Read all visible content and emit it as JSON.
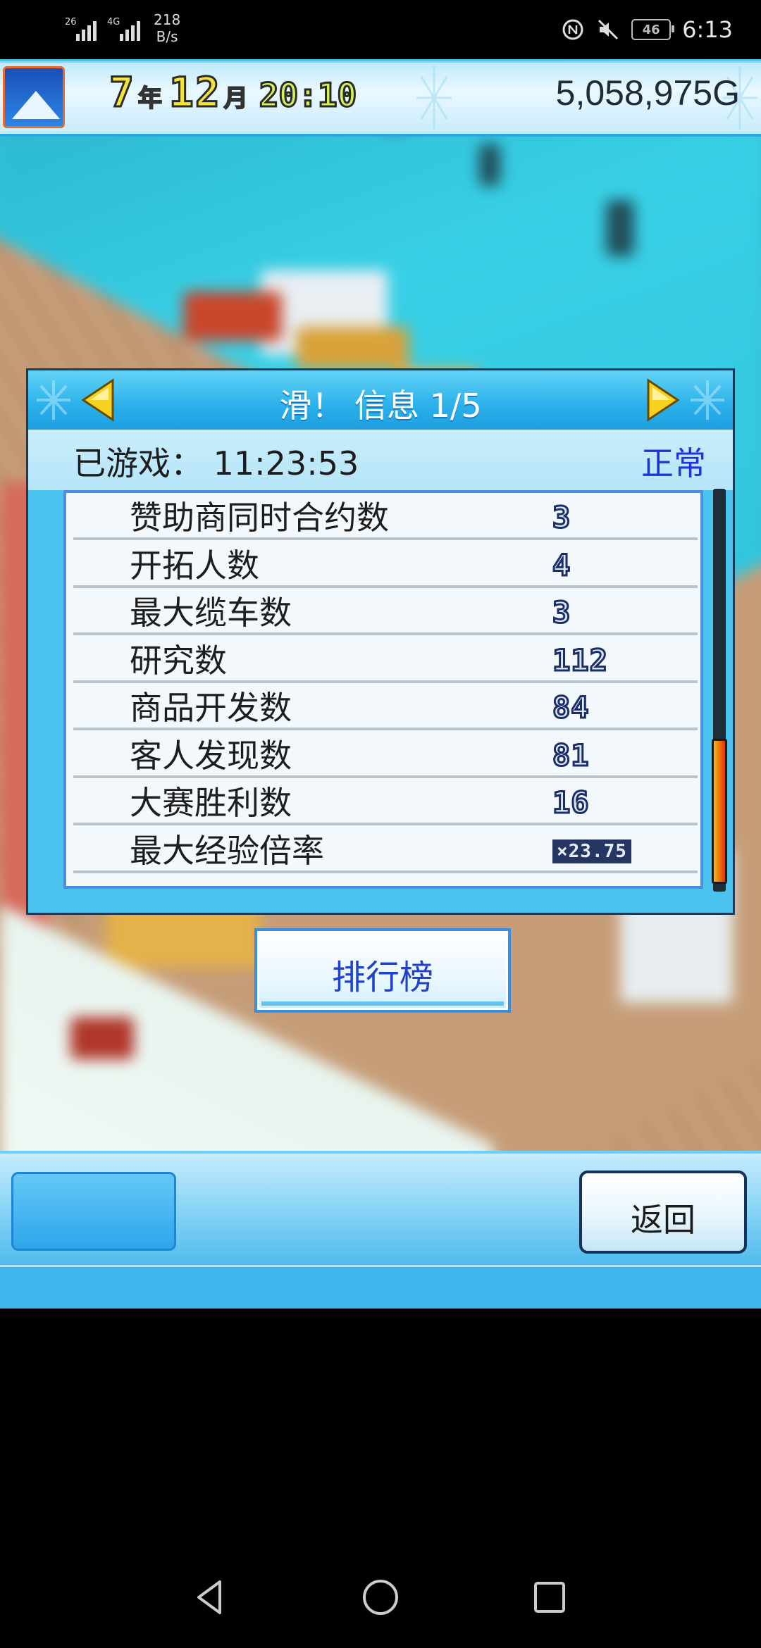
{
  "status_bar": {
    "signal1_label": "26",
    "signal2_label": "4G",
    "net_speed_value": "218",
    "net_speed_unit": "B/s",
    "battery": "46",
    "clock": "6:13",
    "icons": [
      "signal-icon",
      "signal-icon",
      "nfc-icon",
      "mute-icon",
      "battery-icon"
    ]
  },
  "hud": {
    "year": "7",
    "year_unit": "年",
    "month": "12",
    "month_unit": "月",
    "time": "20:10",
    "money": "5,058,975G"
  },
  "info_panel": {
    "title": "滑！ 信息 1/5",
    "played_label": "已游戏：",
    "played_time": "11:23:53",
    "mode": "正常",
    "rows": [
      {
        "label": "赞助商同时合约数",
        "value": "3"
      },
      {
        "label": "开拓人数",
        "value": "4"
      },
      {
        "label": "最大缆车数",
        "value": "3"
      },
      {
        "label": "研究数",
        "value": "112"
      },
      {
        "label": "商品开发数",
        "value": "84"
      },
      {
        "label": "客人发现数",
        "value": "81"
      },
      {
        "label": "大赛胜利数",
        "value": "16"
      },
      {
        "label": "最大经验倍率",
        "value": "×23.75"
      }
    ],
    "scroll_position": 0.62,
    "scroll_visible_fraction": 0.36
  },
  "ranking_button": {
    "label": "排行榜"
  },
  "bottom_bar": {
    "back_label": "返回"
  },
  "colors": {
    "panel_blue": "#4cc3ef",
    "mode_text": "#2233d8",
    "arrow_yellow": "#f7d21c",
    "money_text": "#1f2c36"
  }
}
